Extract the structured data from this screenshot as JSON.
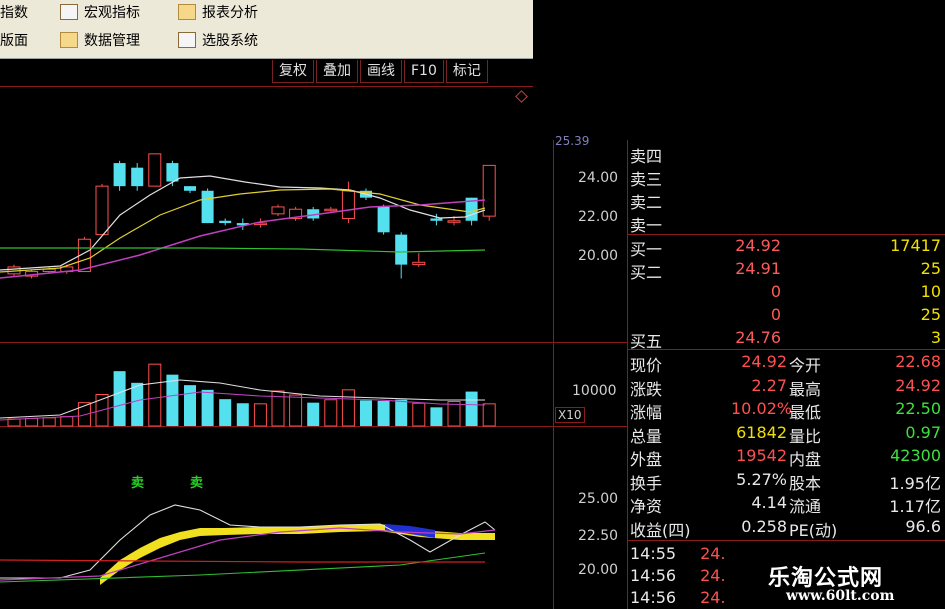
{
  "toolbar": {
    "items": [
      {
        "label": "指数",
        "icon": "index-icon"
      },
      {
        "label": "宏观指标",
        "icon": "macro-chart-icon"
      },
      {
        "label": "报表分析",
        "icon": "report-icon"
      },
      {
        "label": "版面",
        "icon": "layout-icon"
      },
      {
        "label": "数据管理",
        "icon": "data-manage-icon"
      },
      {
        "label": "选股系统",
        "icon": "stock-select-icon"
      }
    ]
  },
  "tabs": [
    "复权",
    "叠加",
    "画线",
    "F10",
    "标记"
  ],
  "price_axis": [
    "24.00",
    "22.00",
    "20.00"
  ],
  "price_axis_top": "25.39",
  "volume_axis": [
    "10000"
  ],
  "volume_unit": "X10",
  "macd_axis": [
    "25.00",
    "22.50",
    "20.00"
  ],
  "sell_signal": "卖",
  "orderbook": {
    "sells": [
      {
        "label": "卖四",
        "price": "",
        "vol": ""
      },
      {
        "label": "卖三",
        "price": "",
        "vol": ""
      },
      {
        "label": "卖二",
        "price": "",
        "vol": ""
      },
      {
        "label": "卖一",
        "price": "",
        "vol": ""
      }
    ],
    "buys": [
      {
        "label": "买一",
        "price": "24.92",
        "vol": "17417"
      },
      {
        "label": "买二",
        "price": "24.91",
        "vol": "25"
      },
      {
        "label": "",
        "price": "0",
        "vol": "10"
      },
      {
        "label": "",
        "price": "0",
        "vol": "25"
      },
      {
        "label": "买五",
        "price": "24.76",
        "vol": "3"
      }
    ]
  },
  "quote": [
    {
      "l1": "现价",
      "v1": "24.92",
      "c1": "red",
      "l2": "今开",
      "v2": "22.68",
      "c2": "red"
    },
    {
      "l1": "涨跌",
      "v1": "2.27",
      "c1": "red",
      "l2": "最高",
      "v2": "24.92",
      "c2": "red"
    },
    {
      "l1": "涨幅",
      "v1": "10.02%",
      "c1": "red",
      "l2": "最低",
      "v2": "22.50",
      "c2": "green"
    },
    {
      "l1": "总量",
      "v1": "61842",
      "c1": "yellow",
      "l2": "量比",
      "v2": "0.97",
      "c2": "green"
    },
    {
      "l1": "外盘",
      "v1": "19542",
      "c1": "red",
      "l2": "内盘",
      "v2": "42300",
      "c2": "green"
    },
    {
      "l1": "换手",
      "v1": "5.27%",
      "c1": "white",
      "l2": "股本",
      "v2": "1.95亿",
      "c2": "white"
    },
    {
      "l1": "净资",
      "v1": "4.14",
      "c1": "white",
      "l2": "流通",
      "v2": "1.17亿",
      "c2": "white"
    },
    {
      "l1": "收益(四)",
      "v1": "0.258",
      "c1": "white",
      "l2": "PE(动)",
      "v2": "96.6",
      "c2": "white"
    }
  ],
  "ticks": [
    {
      "time": "14:55",
      "price": "24."
    },
    {
      "time": "14:56",
      "price": "24."
    },
    {
      "time": "14:56",
      "price": "24."
    }
  ],
  "watermark": {
    "title": "乐淘公式网",
    "url": "www.60lt.com"
  },
  "colors": {
    "up": "#ff5050",
    "down": "#55e0f0",
    "grid": "#8b1a1a"
  },
  "chart_data": {
    "type": "candlestick",
    "candles": [
      {
        "o": 20.2,
        "c": 20.5,
        "h": 20.6,
        "l": 20.1
      },
      {
        "o": 20.1,
        "c": 20.3,
        "h": 20.4,
        "l": 20.0
      },
      {
        "o": 20.3,
        "c": 20.4,
        "h": 20.5,
        "l": 20.2
      },
      {
        "o": 20.3,
        "c": 20.5,
        "h": 20.6,
        "l": 20.2
      },
      {
        "o": 20.3,
        "c": 21.7,
        "h": 21.8,
        "l": 20.3
      },
      {
        "o": 21.9,
        "c": 24.0,
        "h": 24.1,
        "l": 21.9
      },
      {
        "o": 25.0,
        "c": 24.0,
        "h": 25.1,
        "l": 23.8
      },
      {
        "o": 24.8,
        "c": 24.0,
        "h": 25.0,
        "l": 23.8
      },
      {
        "o": 24.0,
        "c": 25.4,
        "h": 25.4,
        "l": 24.0
      },
      {
        "o": 25.0,
        "c": 24.2,
        "h": 25.1,
        "l": 24.0
      },
      {
        "o": 24.0,
        "c": 23.8,
        "h": 24.0,
        "l": 23.7
      },
      {
        "o": 23.8,
        "c": 22.4,
        "h": 23.9,
        "l": 22.4
      },
      {
        "o": 22.5,
        "c": 22.4,
        "h": 22.6,
        "l": 22.3
      },
      {
        "o": 22.4,
        "c": 22.3,
        "h": 22.6,
        "l": 22.1
      },
      {
        "o": 22.4,
        "c": 22.4,
        "h": 22.6,
        "l": 22.2
      },
      {
        "o": 22.8,
        "c": 23.1,
        "h": 23.2,
        "l": 22.7
      },
      {
        "o": 22.6,
        "c": 23.0,
        "h": 23.1,
        "l": 22.5
      },
      {
        "o": 23.0,
        "c": 22.6,
        "h": 23.1,
        "l": 22.5
      },
      {
        "o": 23.0,
        "c": 23.0,
        "h": 23.1,
        "l": 22.9
      },
      {
        "o": 22.6,
        "c": 23.8,
        "h": 24.2,
        "l": 22.4
      },
      {
        "o": 23.8,
        "c": 23.5,
        "h": 23.9,
        "l": 23.4
      },
      {
        "o": 23.1,
        "c": 22.0,
        "h": 23.2,
        "l": 21.9
      },
      {
        "o": 21.9,
        "c": 20.6,
        "h": 22.0,
        "l": 20.0
      },
      {
        "o": 20.6,
        "c": 20.7,
        "h": 21.1,
        "l": 20.5
      },
      {
        "o": 22.6,
        "c": 22.5,
        "h": 22.8,
        "l": 22.3
      },
      {
        "o": 22.5,
        "c": 22.5,
        "h": 22.7,
        "l": 22.3
      },
      {
        "o": 23.5,
        "c": 22.5,
        "h": 23.5,
        "l": 22.3
      },
      {
        "o": 22.7,
        "c": 24.9,
        "h": 24.9,
        "l": 22.5
      }
    ],
    "volumes": [
      1200,
      1300,
      1400,
      1600,
      4000,
      5400,
      9400,
      7400,
      10600,
      8800,
      7000,
      6200,
      4600,
      3900,
      3800,
      6000,
      5300,
      4000,
      4500,
      6200,
      4400,
      4300,
      4500,
      3900,
      3200,
      4200,
      5900,
      3800
    ],
    "ylim": [
      19.5,
      26.0
    ]
  }
}
